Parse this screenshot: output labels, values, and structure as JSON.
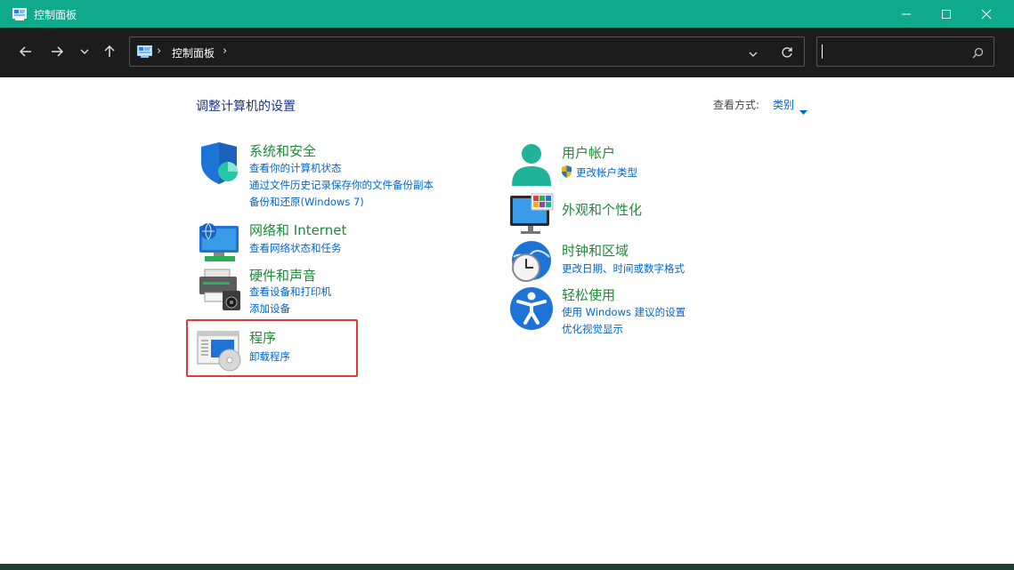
{
  "window": {
    "title": "控制面板",
    "minimize_icon": "minimize-icon",
    "maximize_icon": "maximize-icon",
    "close_icon": "close-icon"
  },
  "toolbar": {
    "breadcrumb": [
      "控制面板"
    ],
    "search": {
      "value": "",
      "placeholder": ""
    }
  },
  "main": {
    "heading": "调整计算机的设置",
    "view_by_label": "查看方式:",
    "view_by_value": "类别",
    "categories": [
      {
        "title": "系统和安全",
        "icon": "shield-icon",
        "links": [
          "查看你的计算机状态",
          "通过文件历史记录保存你的文件备份副本",
          "备份和还原(Windows 7)"
        ]
      },
      {
        "title": "网络和 Internet",
        "icon": "network-icon",
        "links": [
          "查看网络状态和任务"
        ]
      },
      {
        "title": "硬件和声音",
        "icon": "printer-icon",
        "links": [
          "查看设备和打印机",
          "添加设备"
        ]
      },
      {
        "title": "程序",
        "icon": "programs-icon",
        "links": [
          "卸载程序"
        ]
      },
      {
        "title": "用户帐户",
        "icon": "user-icon",
        "links": [
          "更改帐户类型"
        ]
      },
      {
        "title": "外观和个性化",
        "icon": "monitor-icon",
        "links": []
      },
      {
        "title": "时钟和区域",
        "icon": "clock-globe-icon",
        "links": [
          "更改日期、时间或数字格式"
        ]
      },
      {
        "title": "轻松使用",
        "icon": "accessibility-icon",
        "links": [
          "使用 Windows 建议的设置",
          "优化视觉显示"
        ]
      }
    ]
  },
  "colors": {
    "titlebar": "#0eaa8b",
    "toolbar": "#1c1c1c",
    "category_title": "#1e8a3a",
    "link": "#0066cc",
    "heading": "#1e3287",
    "highlight": "#e53935"
  }
}
